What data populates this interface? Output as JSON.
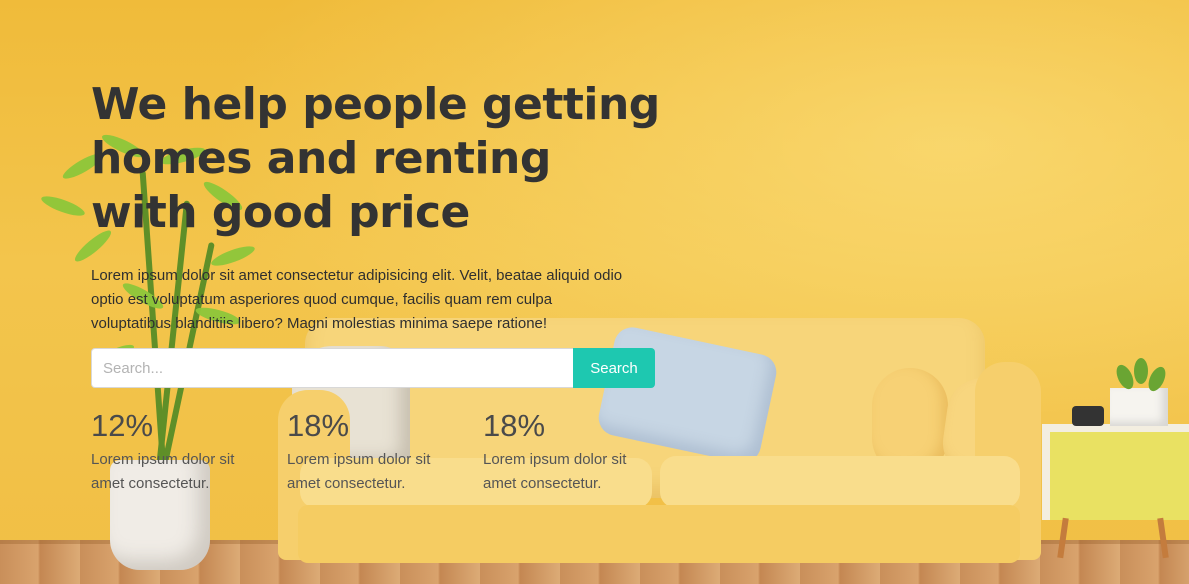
{
  "hero": {
    "title": "We help people getting homes and renting with good price",
    "description": "Lorem ipsum dolor sit amet consectetur adipisicing elit. Velit, beatae aliquid odio optio est voluptatum asperiores quod cumque, facilis quam rem culpa voluptatibus blanditiis libero? Magni molestias minima saepe ratione!"
  },
  "search": {
    "placeholder": "Search...",
    "value": "",
    "button_label": "Search",
    "button_color": "#1ec8b0"
  },
  "stats": [
    {
      "value": "12%",
      "description": "Lorem ipsum dolor sit amet consectetur."
    },
    {
      "value": "18%",
      "description": "Lorem ipsum dolor sit amet consectetur."
    },
    {
      "value": "18%",
      "description": "Lorem ipsum dolor sit amet consectetur."
    }
  ],
  "background": {
    "image_subject": "yellow living room with sofa and plant",
    "wall_color": "#f2c443",
    "accent_pillow_color": "#c7d6e4"
  }
}
